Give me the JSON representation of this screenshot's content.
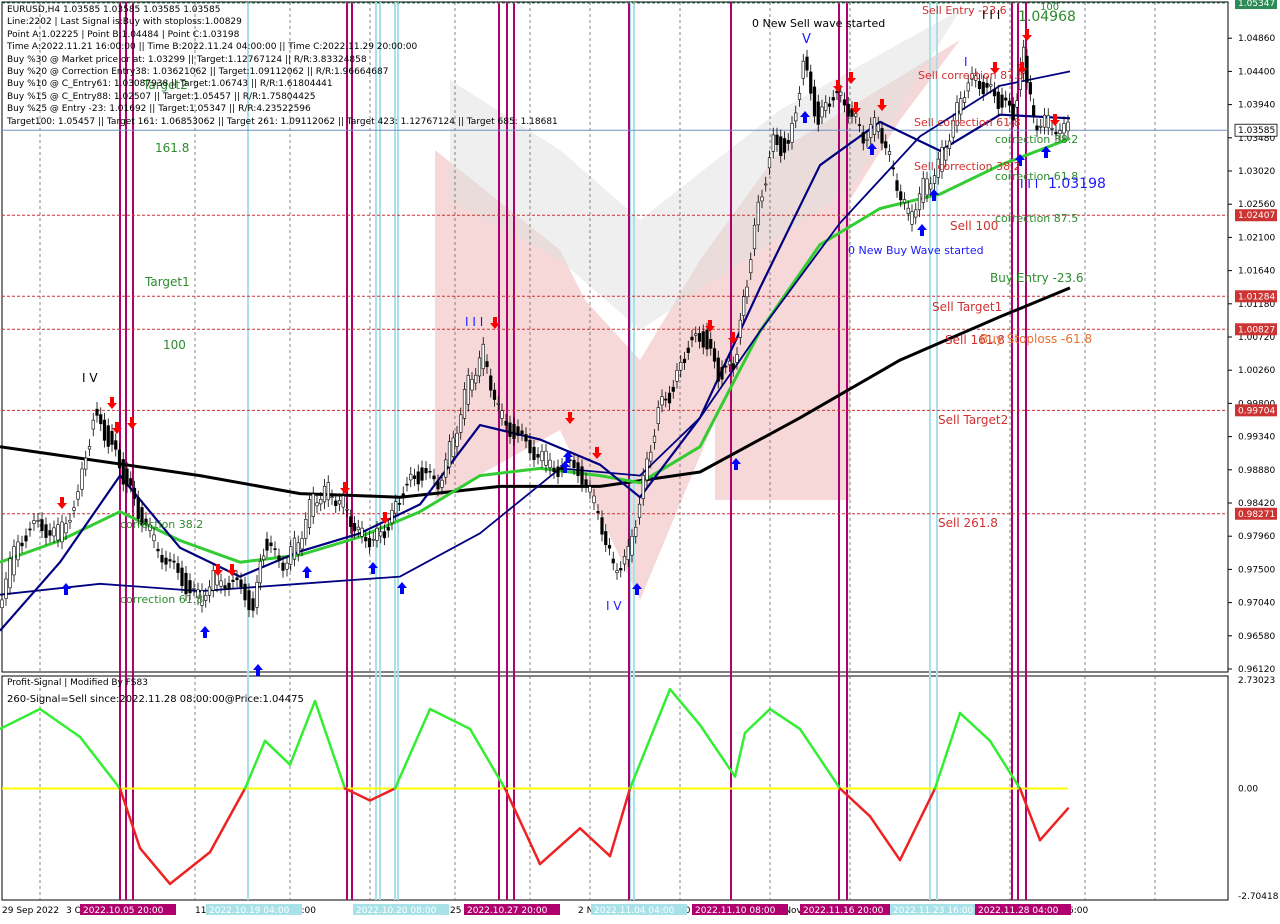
{
  "window": {
    "symbol_title": "EURUSD,H4  1.03585 1.03585 1.03585 1.03585"
  },
  "info_panel": [
    "Line:2202 | Last Signal is:Buy with stoploss:1.00829",
    "Point A:1.02225 | Point B:1.04484 | Point C:1.03198",
    "Time A:2022.11.21 16:00:00 || Time B:2022.11.24 04:00:00 || Time C:2022.11.29 20:00:00",
    "Buy %30 @ Market price or at: 1.03299 || Target:1.12767124 || R/R:3.83324858",
    "Buy %20 @ Correction Entry38: 1.03621062 || Target:1.09112062 || R/R:1.96664687",
    "Buy %10 @ C_Entry61: 1.03087938 || Target:1.06743 || R/R:1.61804441",
    "Buy %15 @ C_Entry88: 1.02507 || Target:1.05457 || R/R:1.75804425",
    "Buy %25 @ Entry -23: 1.01692 || Target:1.05347 || R/R:4.23522596",
    "Target100: 1.05457 || Target 161: 1.06853062 || Target 261: 1.09112062 || Target 423: 1.12767124 || Target 685: 1.18681"
  ],
  "price_axis": {
    "ticks": [
      "1.04860",
      "1.04400",
      "1.03940",
      "1.03480",
      "1.03020",
      "1.02560",
      "1.02100",
      "1.01640",
      "1.01180",
      "1.00720",
      "1.00260",
      "0.99800",
      "0.99340",
      "0.98880",
      "0.98420",
      "0.97960",
      "0.97500",
      "0.97040",
      "0.96580",
      "0.96120"
    ],
    "current_price": "1.03585",
    "level_tags": [
      {
        "label": "1.05347",
        "color": "#2e8b57"
      },
      {
        "label": "1.02407",
        "color": "#cc3333"
      },
      {
        "label": "1.01284",
        "color": "#cc3333"
      },
      {
        "label": "1.00827",
        "color": "#cc3333"
      },
      {
        "label": "0.99704",
        "color": "#cc3333"
      },
      {
        "label": "0.98271",
        "color": "#cc3333"
      }
    ]
  },
  "osc_axis": {
    "ticks": [
      "2.73023",
      "0.00",
      "-2.70418"
    ]
  },
  "time_axis": {
    "labels": [
      "29 Sep 2022",
      "3 Oct",
      "11",
      "16:00",
      "25",
      "2 N",
      "6:0",
      "14 Nov",
      "0",
      "6:00"
    ],
    "highlighted": [
      "2022.10.05 20:00",
      "2022.10.19 04:00",
      "2022.10.20 08:00",
      "2022.10.27 20:00",
      "2022.11.04 04:00",
      "2022.11.10 08:00",
      "2022.11.16 20:00",
      "2022.11.23 16:00",
      "2022.11.28 04:00"
    ]
  },
  "annotations": {
    "new_sell_wave": "0 New Sell wave started",
    "new_buy_wave": "0 New Buy Wave started",
    "sell_entry": "Sell Entry -23.6",
    "sell_correction_875": "Sell correction 87.5",
    "sell_correction_618": "Sell correction 61.8",
    "sell_correction_382": "Sell correction 38.2",
    "sell_100": "Sell 100",
    "sell_target1": "Sell Target1",
    "sell_1618": "Sell 161.8",
    "sell_target2": "Sell Target2",
    "sell_2618": "Sell 261.8",
    "buy_entry": "Buy Entry -23.6",
    "buy_stoploss": "Buy Stoploss -61.8",
    "correction_382_r": "correction 38.2",
    "correction_618_r": "correction 61.8",
    "correction_875_r": "correction 87.5",
    "correction_382_l": "correction 38.2",
    "correction_618_l": "correction 61.8",
    "target_1618": "161.8",
    "target1": "Target1",
    "target_100": "100",
    "target_label": "Target2",
    "big_price": "1.04968",
    "big_price2": "1.03198",
    "wave_V": "V",
    "wave_I_V": "I V",
    "wave_I_V2": "I V",
    "wave_III": "I I I",
    "wave_III2": "I I I",
    "wave_III3": "I I I",
    "wave_I": "I",
    "wave_top": "100"
  },
  "oscillator": {
    "title": "Profit-Signal | Modified By FS83",
    "signal": "260-Signal=Sell since:2022.11.28 08:00:00@Price:1.04475"
  },
  "colors": {
    "bull_arrow": "#0000ff",
    "bear_arrow": "#ff0000",
    "magenta_line": "#b0006e",
    "cyan_line": "#a8e2e8",
    "ma_black": "#000000",
    "ma_navy": "#000080",
    "ma_green": "#33cc33",
    "zero_line": "#ffff00"
  },
  "chart_data": {
    "type": "line",
    "title": "EURUSD,H4",
    "price_range": [
      0.9612,
      1.0532
    ],
    "candles_close_approx": [
      [
        0,
        0.97
      ],
      [
        20,
        0.979
      ],
      [
        40,
        0.981
      ],
      [
        60,
        0.98
      ],
      [
        80,
        0.985
      ],
      [
        95,
        0.996
      ],
      [
        110,
        0.993
      ],
      [
        125,
        0.988
      ],
      [
        140,
        0.983
      ],
      [
        160,
        0.978
      ],
      [
        180,
        0.974
      ],
      [
        200,
        0.971
      ],
      [
        215,
        0.974
      ],
      [
        235,
        0.973
      ],
      [
        255,
        0.97
      ],
      [
        265,
        0.978
      ],
      [
        285,
        0.976
      ],
      [
        300,
        0.979
      ],
      [
        315,
        0.985
      ],
      [
        330,
        0.986
      ],
      [
        345,
        0.984
      ],
      [
        360,
        0.98
      ],
      [
        375,
        0.979
      ],
      [
        390,
        0.981
      ],
      [
        405,
        0.986
      ],
      [
        420,
        0.988
      ],
      [
        440,
        0.987
      ],
      [
        455,
        0.993
      ],
      [
        470,
        1.001
      ],
      [
        485,
        1.005
      ],
      [
        500,
        0.997
      ],
      [
        520,
        0.993
      ],
      [
        540,
        0.991
      ],
      [
        560,
        0.989
      ],
      [
        580,
        0.989
      ],
      [
        600,
        0.983
      ],
      [
        615,
        0.975
      ],
      [
        630,
        0.977
      ],
      [
        645,
        0.987
      ],
      [
        660,
        0.997
      ],
      [
        675,
        1.0
      ],
      [
        690,
        1.006
      ],
      [
        705,
        1.007
      ],
      [
        720,
        1.002
      ],
      [
        735,
        1.003
      ],
      [
        745,
        1.012
      ],
      [
        760,
        1.025
      ],
      [
        775,
        1.034
      ],
      [
        790,
        1.033
      ],
      [
        805,
        1.045
      ],
      [
        820,
        1.037
      ],
      [
        835,
        1.041
      ],
      [
        850,
        1.039
      ],
      [
        865,
        1.035
      ],
      [
        880,
        1.037
      ],
      [
        895,
        1.03
      ],
      [
        910,
        1.024
      ],
      [
        925,
        1.028
      ],
      [
        940,
        1.031
      ],
      [
        955,
        1.037
      ],
      [
        970,
        1.043
      ],
      [
        985,
        1.042
      ],
      [
        1000,
        1.04
      ],
      [
        1015,
        1.038
      ],
      [
        1025,
        1.047
      ],
      [
        1035,
        1.037
      ],
      [
        1050,
        1.037
      ],
      [
        1070,
        1.0358
      ]
    ],
    "ma_black": [
      [
        0,
        0.992
      ],
      [
        100,
        0.99
      ],
      [
        200,
        0.988
      ],
      [
        300,
        0.9855
      ],
      [
        400,
        0.985
      ],
      [
        500,
        0.9865
      ],
      [
        600,
        0.9865
      ],
      [
        700,
        0.9885
      ],
      [
        800,
        0.996
      ],
      [
        900,
        1.004
      ],
      [
        1000,
        1.01
      ],
      [
        1070,
        1.014
      ]
    ],
    "ma_navy_fast": [
      [
        0,
        0.9665
      ],
      [
        60,
        0.976
      ],
      [
        120,
        0.988
      ],
      [
        180,
        0.978
      ],
      [
        240,
        0.974
      ],
      [
        300,
        0.9775
      ],
      [
        360,
        0.98
      ],
      [
        420,
        0.984
      ],
      [
        480,
        0.995
      ],
      [
        540,
        0.993
      ],
      [
        600,
        0.9895
      ],
      [
        640,
        0.985
      ],
      [
        700,
        0.996
      ],
      [
        760,
        1.014
      ],
      [
        820,
        1.031
      ],
      [
        880,
        1.037
      ],
      [
        940,
        1.033
      ],
      [
        1000,
        1.038
      ],
      [
        1070,
        1.0375
      ]
    ],
    "ma_navy_slow": [
      [
        0,
        0.9715
      ],
      [
        100,
        0.973
      ],
      [
        200,
        0.972
      ],
      [
        300,
        0.973
      ],
      [
        400,
        0.974
      ],
      [
        480,
        0.98
      ],
      [
        560,
        0.989
      ],
      [
        640,
        0.988
      ],
      [
        700,
        0.996
      ],
      [
        760,
        1.008
      ],
      [
        840,
        1.023
      ],
      [
        920,
        1.035
      ],
      [
        1000,
        1.042
      ],
      [
        1070,
        1.044
      ]
    ],
    "ma_green": [
      [
        0,
        0.976
      ],
      [
        60,
        0.979
      ],
      [
        120,
        0.983
      ],
      [
        180,
        0.979
      ],
      [
        240,
        0.976
      ],
      [
        300,
        0.977
      ],
      [
        360,
        0.9795
      ],
      [
        420,
        0.983
      ],
      [
        480,
        0.988
      ],
      [
        540,
        0.989
      ],
      [
        600,
        0.988
      ],
      [
        640,
        0.987
      ],
      [
        700,
        0.992
      ],
      [
        760,
        1.008
      ],
      [
        820,
        1.02
      ],
      [
        880,
        1.025
      ],
      [
        940,
        1.027
      ],
      [
        1000,
        1.031
      ],
      [
        1070,
        1.0347
      ]
    ],
    "oscillator": [
      [
        0,
        1.5
      ],
      [
        40,
        2.0
      ],
      [
        80,
        1.3
      ],
      [
        120,
        0.0
      ],
      [
        140,
        -1.5
      ],
      [
        170,
        -2.4
      ],
      [
        210,
        -1.6
      ],
      [
        245,
        0.0
      ],
      [
        265,
        1.2
      ],
      [
        290,
        0.6
      ],
      [
        315,
        2.2
      ],
      [
        345,
        0.0
      ],
      [
        370,
        -0.3
      ],
      [
        395,
        0.0
      ],
      [
        430,
        2.0
      ],
      [
        470,
        1.5
      ],
      [
        505,
        0.0
      ],
      [
        540,
        -1.9
      ],
      [
        580,
        -1.0
      ],
      [
        610,
        -1.7
      ],
      [
        630,
        0.0
      ],
      [
        670,
        2.5
      ],
      [
        700,
        1.6
      ],
      [
        735,
        0.3
      ],
      [
        745,
        1.4
      ],
      [
        770,
        2.0
      ],
      [
        800,
        1.5
      ],
      [
        840,
        0.0
      ],
      [
        870,
        -0.7
      ],
      [
        900,
        -1.8
      ],
      [
        935,
        0.0
      ],
      [
        960,
        1.9
      ],
      [
        990,
        1.2
      ],
      [
        1020,
        0.0
      ],
      [
        1040,
        -1.3
      ],
      [
        1068,
        -0.5
      ]
    ]
  }
}
